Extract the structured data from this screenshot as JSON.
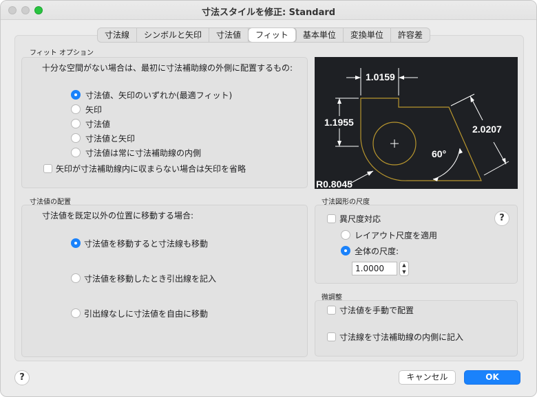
{
  "window": {
    "title": "寸法スタイルを修正: Standard"
  },
  "tabs": [
    {
      "label": "寸法線"
    },
    {
      "label": "シンボルと矢印"
    },
    {
      "label": "寸法値"
    },
    {
      "label": "フィット"
    },
    {
      "label": "基本単位"
    },
    {
      "label": "変換単位"
    },
    {
      "label": "許容差"
    }
  ],
  "fit_options": {
    "label": "フィット オプション",
    "question": "十分な空間がない場合は、最初に寸法補助線の外側に配置するもの:",
    "radios": [
      {
        "label": "寸法値、矢印のいずれか(最適フィット)",
        "selected": true
      },
      {
        "label": "矢印",
        "selected": false
      },
      {
        "label": "寸法値",
        "selected": false
      },
      {
        "label": "寸法値と矢印",
        "selected": false
      },
      {
        "label": "寸法値は常に寸法補助線の内側",
        "selected": false
      }
    ],
    "suppress_arrows": {
      "label": "矢印が寸法補助線内に収まらない場合は矢印を省略",
      "checked": false
    }
  },
  "preview": {
    "dims": [
      "1.0159",
      "1.1955",
      "2.0207",
      "60°",
      "R0.8045"
    ]
  },
  "text_placement": {
    "label": "寸法値の配置",
    "question": "寸法値を既定以外の位置に移動する場合:",
    "radios": [
      {
        "label": "寸法値を移動すると寸法線も移動",
        "selected": true
      },
      {
        "label": "寸法値を移動したとき引出線を記入",
        "selected": false
      },
      {
        "label": "引出線なしに寸法値を自由に移動",
        "selected": false
      }
    ]
  },
  "scale": {
    "label": "寸法図形の尺度",
    "annotative": {
      "label": "異尺度対応",
      "checked": false
    },
    "radios": [
      {
        "label": "レイアウト尺度を適用",
        "selected": false
      },
      {
        "label": "全体の尺度:",
        "selected": true
      }
    ],
    "value": "1.0000",
    "help": "?"
  },
  "fine_tuning": {
    "label": "微調整",
    "checks": [
      {
        "label": "寸法値を手動で配置",
        "checked": false
      },
      {
        "label": "寸法線を寸法補助線の内側に記入",
        "checked": false
      }
    ]
  },
  "footer": {
    "help": "?",
    "cancel": "キャンセル",
    "ok": "OK"
  },
  "colors": {
    "accent": "#1a82fb",
    "preview_bg": "#1e2024",
    "geometry": "#b8962e",
    "dims": "#ffffff"
  }
}
